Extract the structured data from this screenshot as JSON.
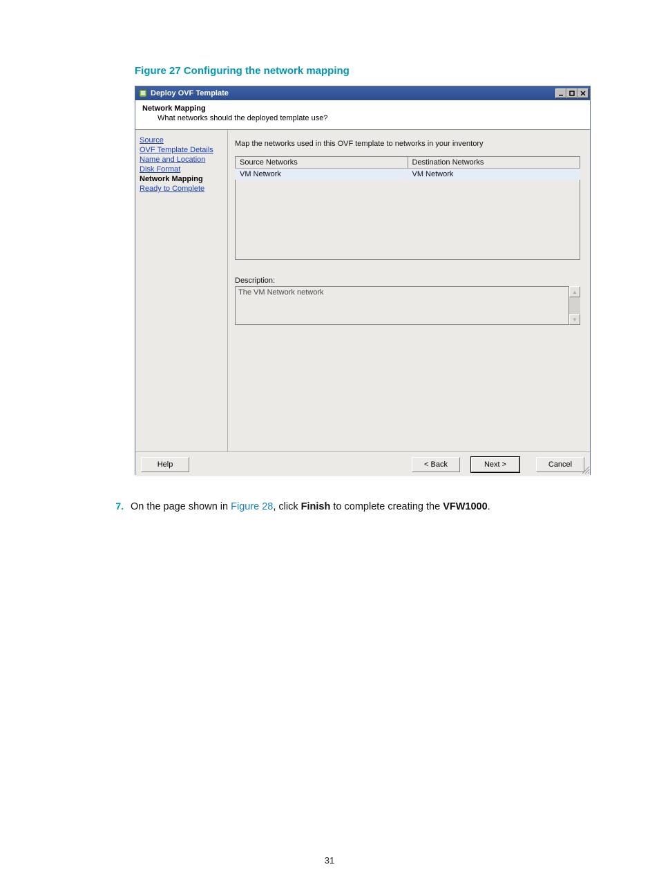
{
  "figure_caption": "Figure 27 Configuring the network mapping",
  "dialog": {
    "title": "Deploy OVF Template",
    "icon_name": "ovf-template-icon",
    "header": {
      "title": "Network Mapping",
      "sub": "What networks should the deployed template use?"
    },
    "nav": {
      "items": [
        {
          "label": "Source"
        },
        {
          "label": "OVF Template Details"
        },
        {
          "label": "Name and Location"
        },
        {
          "label": "Disk Format"
        },
        {
          "label": "Network Mapping",
          "current": true
        },
        {
          "label": "Ready to Complete"
        }
      ]
    },
    "content": {
      "instruction": "Map the networks used in this OVF template to networks in your inventory",
      "table": {
        "columns": [
          "Source Networks",
          "Destination Networks"
        ],
        "rows": [
          {
            "source": "VM Network",
            "destination": "VM Network"
          }
        ]
      },
      "description_label": "Description:",
      "description_value": "The VM Network network"
    },
    "buttons": {
      "help": "Help",
      "back": "< Back",
      "next": "Next >",
      "cancel": "Cancel"
    }
  },
  "step7": {
    "number": "7.",
    "pre": "On the page shown in ",
    "figref": "Figure 28",
    "mid1": ", click ",
    "finish": "Finish",
    "mid2": " to complete creating the ",
    "vfw": "VFW1000",
    "tail": "."
  },
  "page_number": "31"
}
